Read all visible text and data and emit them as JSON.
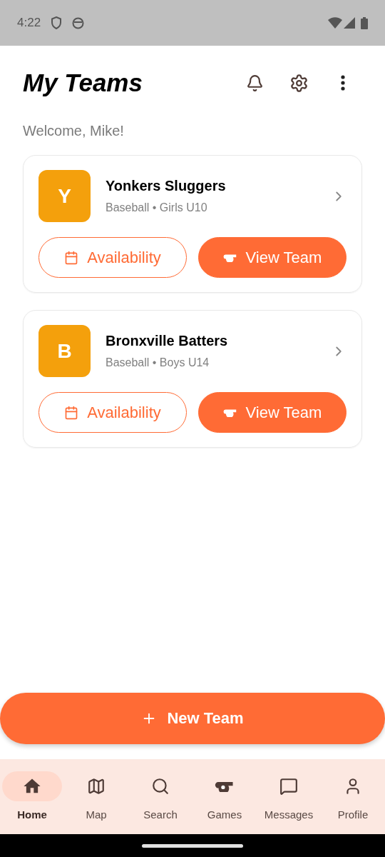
{
  "status_bar": {
    "time": "4:22"
  },
  "header": {
    "title": "My Teams"
  },
  "welcome": "Welcome, Mike!",
  "teams": [
    {
      "initial": "Y",
      "name": "Yonkers Sluggers",
      "details": "Baseball • Girls U10",
      "availability_label": "Availability",
      "view_label": "View Team"
    },
    {
      "initial": "B",
      "name": "Bronxville Batters",
      "details": "Baseball • Boys U14",
      "availability_label": "Availability",
      "view_label": "View Team"
    }
  ],
  "new_team_button": "New Team",
  "bottom_nav": [
    {
      "label": "Home",
      "selected": true
    },
    {
      "label": "Map",
      "selected": false
    },
    {
      "label": "Search",
      "selected": false
    },
    {
      "label": "Games",
      "selected": false
    },
    {
      "label": "Messages",
      "selected": false
    },
    {
      "label": "Profile",
      "selected": false
    }
  ]
}
